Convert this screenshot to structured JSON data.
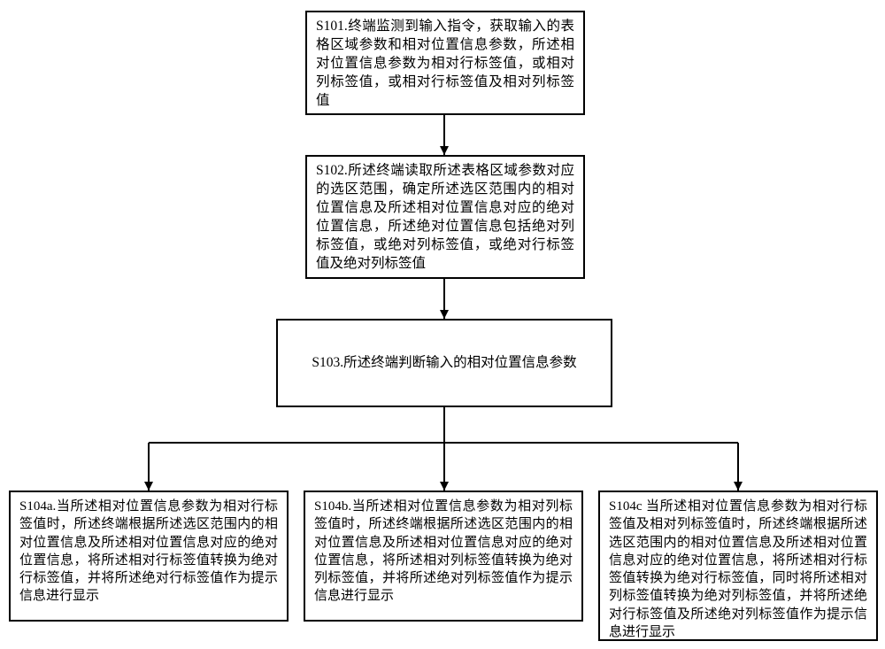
{
  "chart_data": {
    "type": "flowchart",
    "nodes": [
      {
        "id": "s101",
        "label": "S101.终端监测到输入指令，获取输入的表格区域参数和相对位置信息参数，所述相对位置信息参数为相对行标签值，或相对列标签值，或相对行标签值及相对列标签值"
      },
      {
        "id": "s102",
        "label": "S102.所述终端读取所述表格区域参数对应的选区范围，确定所述选区范围内的相对位置信息及所述相对位置信息对应的绝对位置信息，所述绝对位置信息包括绝对列标签值，或绝对列标签值，或绝对行标签值及绝对列标签值"
      },
      {
        "id": "s103",
        "label": "S103.所述终端判断输入的相对位置信息参数"
      },
      {
        "id": "s104a",
        "label": "S104a.当所述相对位置信息参数为相对行标签值时，所述终端根据所述选区范围内的相对位置信息及所述相对位置信息对应的绝对位置信息，将所述相对行标签值转换为绝对行标签值，并将所述绝对行标签值作为提示信息进行显示"
      },
      {
        "id": "s104b",
        "label": "S104b.当所述相对位置信息参数为相对列标签值时，所述终端根据所述选区范围内的相对位置信息及所述相对位置信息对应的绝对位置信息，将所述相对列标签值转换为绝对列标签值，并将所述绝对列标签值作为提示信息进行显示"
      },
      {
        "id": "s104c",
        "label": "S104c 当所述相对位置信息参数为相对行标签值及相对列标签值时，所述终端根据所述选区范围内的相对位置信息及所述相对位置信息对应的绝对位置信息，将所述相对行标签值转换为绝对行标签值，同时将所述相对列标签值转换为绝对列标签值，并将所述绝对行标签值及所述绝对列标签值作为提示信息进行显示"
      }
    ],
    "edges": [
      {
        "from": "s101",
        "to": "s102"
      },
      {
        "from": "s102",
        "to": "s103"
      },
      {
        "from": "s103",
        "to": "s104a"
      },
      {
        "from": "s103",
        "to": "s104b"
      },
      {
        "from": "s103",
        "to": "s104c"
      }
    ]
  },
  "boxes": {
    "s101": "S101.终端监测到输入指令，获取输入的表格区域参数和相对位置信息参数，所述相对位置信息参数为相对行标签值，或相对列标签值，或相对行标签值及相对列标签值",
    "s102": "S102.所述终端读取所述表格区域参数对应的选区范围，确定所述选区范围内的相对位置信息及所述相对位置信息对应的绝对位置信息，所述绝对位置信息包括绝对列标签值，或绝对列标签值，或绝对行标签值及绝对列标签值",
    "s103": "S103.所述终端判断输入的相对位置信息参数",
    "s104a": "S104a.当所述相对位置信息参数为相对行标签值时，所述终端根据所述选区范围内的相对位置信息及所述相对位置信息对应的绝对位置信息，将所述相对行标签值转换为绝对行标签值，并将所述绝对行标签值作为提示信息进行显示",
    "s104b": "S104b.当所述相对位置信息参数为相对列标签值时，所述终端根据所述选区范围内的相对位置信息及所述相对位置信息对应的绝对位置信息，将所述相对列标签值转换为绝对列标签值，并将所述绝对列标签值作为提示信息进行显示",
    "s104c": "S104c 当所述相对位置信息参数为相对行标签值及相对列标签值时，所述终端根据所述选区范围内的相对位置信息及所述相对位置信息对应的绝对位置信息，将所述相对行标签值转换为绝对行标签值，同时将所述相对列标签值转换为绝对列标签值，并将所述绝对行标签值及所述绝对列标签值作为提示信息进行显示"
  }
}
